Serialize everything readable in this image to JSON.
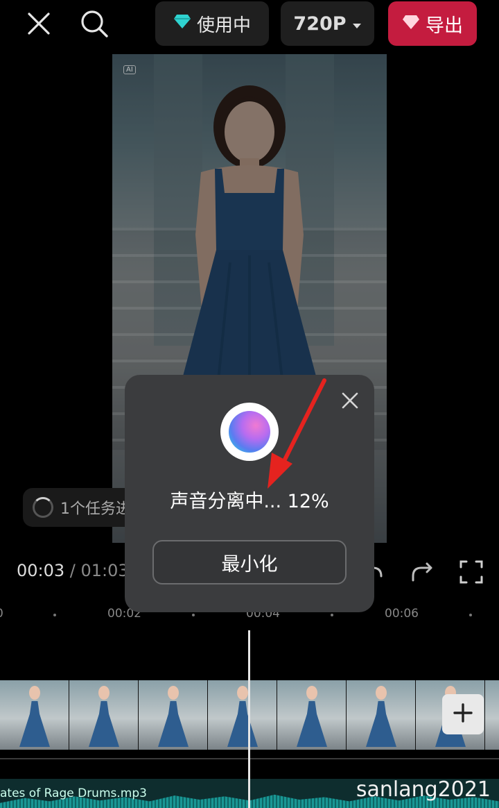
{
  "topbar": {
    "inuse_label": "使用中",
    "resolution_label": "720P",
    "export_label": "导出",
    "accent_export": "#c41c3f"
  },
  "preview": {
    "ai_badge": "AI"
  },
  "task_chip": {
    "label": "1个任务进行中"
  },
  "time": {
    "current": "00:03",
    "total": " / 01:03"
  },
  "ruler": {
    "ticks": [
      "0",
      "00:02",
      "00:04",
      "00:06"
    ]
  },
  "audio": {
    "filename": "ates of Rage Drums.mp3"
  },
  "watermark": "sanlang2021",
  "dialog": {
    "progress_text": "声音分离中... 12%",
    "progress_percent": 12,
    "minimize_label": "最小化"
  },
  "icons": {
    "close": "close-icon",
    "search": "search-icon",
    "diamond": "diamond-icon",
    "chevron": "chevron-down-icon",
    "undo": "undo-icon",
    "redo": "redo-icon",
    "fullscreen": "fullscreen-icon",
    "add": "plus-icon"
  }
}
